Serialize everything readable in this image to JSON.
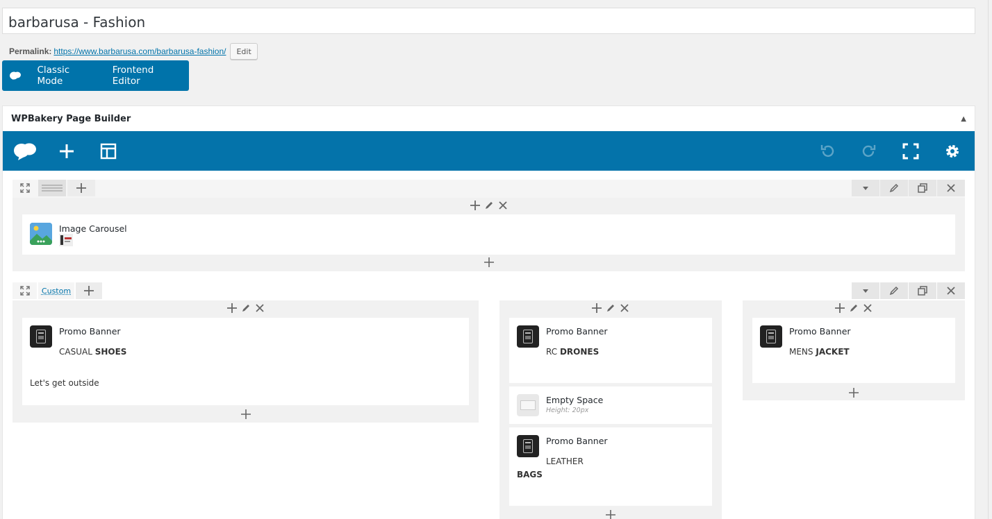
{
  "post": {
    "title": "barbarusa - Fashion",
    "permalink_label": "Permalink:",
    "permalink_url": "https://www.barbarusa.com/barbarusa-fashion/",
    "edit_label": "Edit"
  },
  "mode_bar": {
    "classic_label": "Classic Mode",
    "frontend_label": "Frontend Editor"
  },
  "builder": {
    "title": "WPBakery Page Builder",
    "toggle_icon": "triangle-up-icon",
    "toolbar_left": [
      "logo-icon",
      "add-element-icon",
      "templates-icon"
    ],
    "toolbar_right": [
      "undo-icon",
      "redo-icon",
      "fullscreen-icon",
      "settings-icon"
    ]
  },
  "rows": [
    {
      "layout_label": "",
      "columns": [
        {
          "elements": [
            {
              "type": "image-carousel",
              "name": "Image Carousel"
            }
          ]
        }
      ]
    },
    {
      "layout_label": "Custom",
      "columns": [
        {
          "elements": [
            {
              "type": "promo-banner",
              "name": "Promo Banner",
              "line1_a": "CASUAL",
              "line1_b": "SHOES",
              "line2": "Let's get outside"
            }
          ]
        },
        {
          "elements": [
            {
              "type": "promo-banner",
              "name": "Promo Banner",
              "line1_a": "RC",
              "line1_b": "DRONES"
            },
            {
              "type": "empty-space",
              "name": "Empty Space",
              "hint": "Height: 20px"
            },
            {
              "type": "promo-banner",
              "name": "Promo Banner",
              "line1_a": "LEATHER",
              "line1_b": "BAGS"
            }
          ]
        },
        {
          "elements": [
            {
              "type": "promo-banner",
              "name": "Promo Banner",
              "line1_a": "MENS",
              "line1_b": "JACKET"
            }
          ]
        }
      ]
    }
  ]
}
